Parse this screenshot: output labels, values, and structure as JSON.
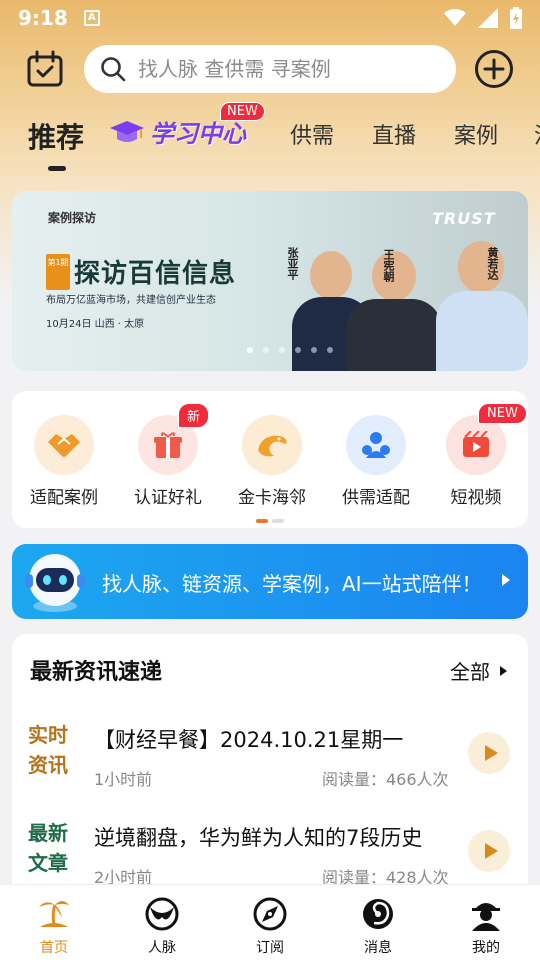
{
  "status_bar": {
    "time": "9:18",
    "notif_letter": "A"
  },
  "search": {
    "placeholder": "找人脉 查供需 寻案例"
  },
  "tabs": [
    {
      "label": "推荐"
    },
    {
      "label": "学习中心",
      "badge": "NEW"
    },
    {
      "label": "供需"
    },
    {
      "label": "直播"
    },
    {
      "label": "案例"
    },
    {
      "label": "活"
    }
  ],
  "banner": {
    "brand_left": "案例探访",
    "tag": "第1期",
    "title": "探访百信信息",
    "subtitle": "布局万亿蓝海市场，共建信创产业生态",
    "date": "10月24日  山西 · 太原",
    "logo": "TRUST",
    "people": [
      "张亚平",
      "王宪朝",
      "黄若达"
    ],
    "page_count": 6,
    "active_page": 1
  },
  "quick_menu": [
    {
      "label": "适配案例",
      "icon": "handshake-icon",
      "color": "#f09a2a",
      "bg": "#fdecd8"
    },
    {
      "label": "认证好礼",
      "icon": "gift-icon",
      "color": "#f05a4a",
      "bg": "#fde6e2",
      "badge": "新"
    },
    {
      "label": "金卡海邻",
      "icon": "dolphin-icon",
      "color": "#f0a22a",
      "bg": "#fdecd4"
    },
    {
      "label": "供需适配",
      "icon": "people-icon",
      "color": "#2a7cf0",
      "bg": "#e3eefc"
    },
    {
      "label": "短视频",
      "icon": "video-icon",
      "color": "#f04a3a",
      "bg": "#fde3e0",
      "badge": "NEW"
    }
  ],
  "ai_banner": {
    "text": "找人脉、链资源、学案例，AI一站式陪伴！"
  },
  "news": {
    "title": "最新资讯速递",
    "all_label": "全部",
    "items": [
      {
        "tag": "实时资讯",
        "tag_color": "#b7731c",
        "headline": "【财经早餐】2024.10.21星期一",
        "time": "1小时前",
        "reads": "阅读量：466人次"
      },
      {
        "tag": "最新文章",
        "tag_color": "#1f6b4a",
        "headline": "逆境翻盘，华为鲜为人知的7段历史",
        "time": "2小时前",
        "reads": "阅读量：428人次"
      }
    ]
  },
  "bottom_nav": [
    {
      "label": "首页",
      "icon": "home-island-icon",
      "active": true
    },
    {
      "label": "人脉",
      "icon": "contacts-icon"
    },
    {
      "label": "订阅",
      "icon": "compass-icon"
    },
    {
      "label": "消息",
      "icon": "message-swirl-icon"
    },
    {
      "label": "我的",
      "icon": "profile-icon"
    }
  ],
  "colors": {
    "accent": "#e28a1e",
    "active_tab": "#222222",
    "badge_red": "#f02c3c"
  }
}
